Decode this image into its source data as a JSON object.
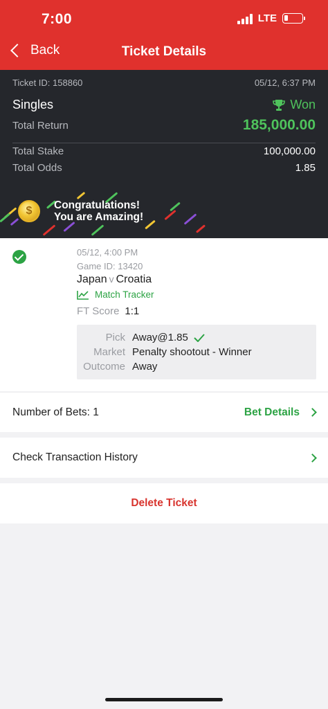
{
  "status_bar": {
    "time": "7:00",
    "network": "LTE"
  },
  "nav": {
    "back_label": "Back",
    "title": "Ticket Details"
  },
  "ticket": {
    "id_text": "Ticket ID: 158860",
    "datetime": "05/12, 6:37 PM",
    "type": "Singles",
    "result": "Won",
    "total_return_label": "Total Return",
    "total_return": "185,000.00",
    "total_stake_label": "Total Stake",
    "total_stake": "100,000.00",
    "total_odds_label": "Total Odds",
    "total_odds": "1.85",
    "congrats_line1": "Congratulations!",
    "congrats_line2": "You are Amazing!"
  },
  "bet": {
    "datetime": "05/12, 4:00 PM",
    "game_id_text": "Game ID: 13420",
    "home": "Japan",
    "vs": "v",
    "away": "Croatia",
    "tracker_label": "Match Tracker",
    "score_label": "FT Score",
    "score": "1:1",
    "pick_label": "Pick",
    "pick": "Away@1.85",
    "market_label": "Market",
    "market": "Penalty shootout - Winner",
    "outcome_label": "Outcome",
    "outcome": "Away"
  },
  "rows": {
    "bets_count_text": "Number of Bets: 1",
    "bet_details_label": "Bet Details",
    "history_label": "Check Transaction History",
    "delete_label": "Delete Ticket"
  },
  "colors": {
    "brand_red": "#e0312d",
    "win_green": "#4fc35c",
    "link_green": "#2ca344",
    "dark_bg": "#25272c"
  }
}
